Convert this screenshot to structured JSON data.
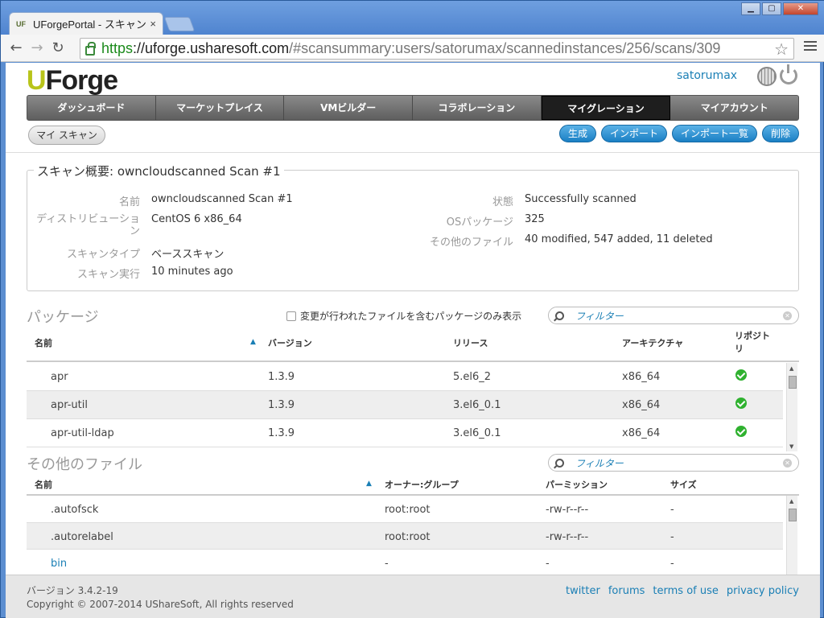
{
  "browser": {
    "tab_title": "UForgePortal - スキャン",
    "favicon_text": "UF",
    "tab_close": "×",
    "url_scheme": "https",
    "url_host": "://uforge.usharesoft.com",
    "url_path": "/#scansummary:users/satorumax/scannedinstances/256/scans/309",
    "window_controls": [
      "▁",
      "▢",
      "✕"
    ]
  },
  "header": {
    "logo_u": "U",
    "logo_rest": "Forge",
    "username": "satorumax"
  },
  "nav": {
    "items": [
      "ダッシュボード",
      "マーケットプレイス",
      "VMビルダー",
      "コラボレーション",
      "マイグレーション",
      "マイアカウント"
    ],
    "active": "マイグレーション"
  },
  "subnav": {
    "tab": "マイ スキャン"
  },
  "actions": [
    "生成",
    "インポート",
    "インポート一覧",
    "削除"
  ],
  "summary": {
    "title": "スキャン概要: owncloudscanned Scan #1",
    "left": [
      {
        "label": "名前",
        "value": "owncloudscanned Scan #1"
      },
      {
        "label": "ディストリビューション",
        "value": "CentOS 6 x86_64"
      },
      {
        "label": "スキャンタイプ",
        "value": "ベーススキャン"
      },
      {
        "label": "スキャン実行",
        "value": "10 minutes ago"
      }
    ],
    "right": [
      {
        "label": "状態",
        "value": "Successfully scanned"
      },
      {
        "label": "OSパッケージ",
        "value": "325"
      },
      {
        "label": "その他のファイル",
        "value": "40 modified, 547 added, 11 deleted"
      }
    ]
  },
  "packages": {
    "title": "パッケージ",
    "checkbox_label": "変更が行われたファイルを含むパッケージのみ表示",
    "filter_placeholder": "フィルター",
    "columns": [
      "名前",
      "バージョン",
      "リリース",
      "アーキテクチャ",
      "リポジトリ"
    ],
    "rows": [
      [
        "apr",
        "1.3.9",
        "5.el6_2",
        "x86_64"
      ],
      [
        "apr-util",
        "1.3.9",
        "3.el6_0.1",
        "x86_64"
      ],
      [
        "apr-util-ldap",
        "1.3.9",
        "3.el6_0.1",
        "x86_64"
      ]
    ]
  },
  "other_files": {
    "title": "その他のファイル",
    "filter_placeholder": "フィルター",
    "columns": [
      "名前",
      "オーナー:グループ",
      "パーミッション",
      "サイズ"
    ],
    "rows": [
      [
        ".autofsck",
        "root:root",
        "-rw-r--r--",
        "-"
      ],
      [
        ".autorelabel",
        "root:root",
        "-rw-r--r--",
        "-"
      ],
      [
        "bin",
        "-",
        "-",
        "-"
      ]
    ]
  },
  "footer": {
    "version": "バージョン 3.4.2-19",
    "copyright": "Copyright © 2007-2014 UShareSoft, All rights reserved",
    "links": [
      "twitter",
      "forums",
      "terms of use",
      "privacy policy"
    ]
  },
  "colors": {
    "accent": "#1a7fb5",
    "logo_accent": "#b8c41a",
    "ok_green": "#2fb12f"
  }
}
